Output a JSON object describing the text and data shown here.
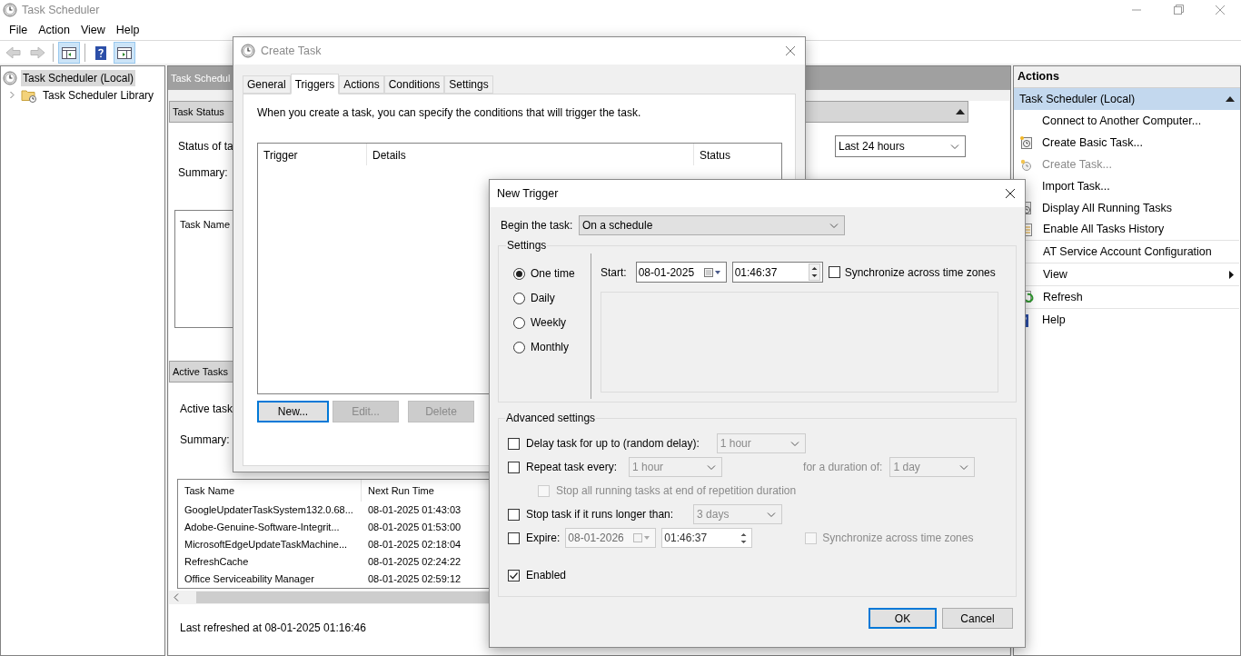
{
  "window": {
    "title": "Task Scheduler"
  },
  "menu": [
    "File",
    "Action",
    "View",
    "Help"
  ],
  "toolbar": [
    {
      "kind": "back",
      "disabled": true,
      "pressed": false
    },
    {
      "kind": "forward",
      "disabled": true,
      "pressed": false
    },
    {
      "kind": "console-tree",
      "disabled": false,
      "pressed": true
    },
    {
      "kind": "help",
      "disabled": false,
      "pressed": false
    },
    {
      "kind": "action-pane",
      "disabled": false,
      "pressed": true
    }
  ],
  "tree": [
    {
      "label": "Task Scheduler (Local)",
      "selected": true,
      "children": [
        {
          "label": "Task Scheduler Library",
          "selected": false,
          "expanded": false
        }
      ]
    }
  ],
  "center_pane": {
    "header": "Task Schedul",
    "task_status": {
      "title": "Task Status",
      "status_label": "Status of ta",
      "period": "Last 24 hours",
      "summary_label": "Summary:",
      "table_header": "Task Name"
    },
    "active_tasks": {
      "title": "Active Tasks",
      "label": "Active task",
      "summary_label": "Summary:",
      "columns": [
        "Task Name",
        "Next Run Time"
      ],
      "rows": [
        [
          "GoogleUpdaterTaskSystem132.0.68...",
          "08-01-2025 01:43:03"
        ],
        [
          "Adobe-Genuine-Software-Integrit...",
          "08-01-2025 01:53:00"
        ],
        [
          "MicrosoftEdgeUpdateTaskMachine...",
          "08-01-2025 02:18:04"
        ],
        [
          "RefreshCache",
          "08-01-2025 02:24:22"
        ],
        [
          "Office Serviceability Manager",
          "08-01-2025 02:59:12"
        ]
      ],
      "last_refreshed": "Last refreshed at 08-01-2025 01:16:46"
    }
  },
  "actions_pane": {
    "title": "Actions",
    "group": {
      "label": "Task Scheduler (Local)",
      "expanded": true
    },
    "items": [
      {
        "label": "Connect to Another Computer...",
        "kind": "plain",
        "disabled": false,
        "separator": false
      },
      {
        "label": "Create Basic Task...",
        "kind": "basic-task",
        "disabled": false,
        "separator": false
      },
      {
        "label": "Create Task...",
        "kind": "task",
        "disabled": true,
        "separator": false
      },
      {
        "label": "Import Task...",
        "kind": "plain",
        "disabled": false,
        "separator": false
      },
      {
        "label": "Display All Running Tasks",
        "kind": "running",
        "disabled": false,
        "separator": false
      },
      {
        "label": "Enable All Tasks History",
        "kind": "history",
        "disabled": false,
        "separator": true
      },
      {
        "label": "AT Service Account Configuration",
        "kind": "plain",
        "disabled": false,
        "separator": true
      },
      {
        "label": "View",
        "kind": "submenu",
        "disabled": false,
        "separator": true
      },
      {
        "label": "Refresh",
        "kind": "refresh",
        "disabled": false,
        "separator": true
      },
      {
        "label": "Help",
        "kind": "help",
        "disabled": false,
        "separator": false
      }
    ]
  },
  "create_task": {
    "title": "Create Task",
    "tabs": [
      {
        "label": "General",
        "selected": false
      },
      {
        "label": "Triggers",
        "selected": true
      },
      {
        "label": "Actions",
        "selected": false
      },
      {
        "label": "Conditions",
        "selected": false
      },
      {
        "label": "Settings",
        "selected": false
      }
    ],
    "description": "When you create a task, you can specify the conditions that will trigger the task.",
    "columns": [
      "Trigger",
      "Details",
      "Status"
    ],
    "buttons": [
      {
        "label": "New...",
        "disabled": false,
        "default": true
      },
      {
        "label": "Edit...",
        "disabled": true,
        "default": false
      },
      {
        "label": "Delete",
        "disabled": true,
        "default": false
      }
    ]
  },
  "new_trigger": {
    "title": "New Trigger",
    "begin_label": "Begin the task:",
    "begin_value": "On a schedule",
    "settings": {
      "title": "Settings",
      "schedules": [
        {
          "label": "One time",
          "selected": true
        },
        {
          "label": "Daily",
          "selected": false
        },
        {
          "label": "Weekly",
          "selected": false
        },
        {
          "label": "Monthly",
          "selected": false
        }
      ],
      "start_label": "Start:",
      "start_date": "08-01-2025",
      "start_time": "01:46:37",
      "sync_label": "Synchronize across time zones",
      "sync_checked": false
    },
    "advanced": {
      "title": "Advanced settings",
      "delay": {
        "label": "Delay task for up to (random delay):",
        "checked": false,
        "value": "1 hour"
      },
      "repeat": {
        "label": "Repeat task every:",
        "checked": false,
        "value": "1 hour",
        "duration_label": "for a duration of:",
        "duration_value": "1 day"
      },
      "stop_all": {
        "label": "Stop all running tasks at end of repetition duration",
        "checked": false,
        "disabled": true
      },
      "stop_if": {
        "label": "Stop task if it runs longer than:",
        "checked": false,
        "value": "3 days"
      },
      "expire": {
        "label": "Expire:",
        "checked": false,
        "date": "08-01-2026",
        "time": "01:46:37",
        "sync_label": "Synchronize across time zones",
        "sync_checked": false
      },
      "enabled": {
        "label": "Enabled",
        "checked": true
      }
    },
    "buttons": [
      {
        "label": "OK",
        "default": true
      },
      {
        "label": "Cancel",
        "default": false
      }
    ]
  }
}
